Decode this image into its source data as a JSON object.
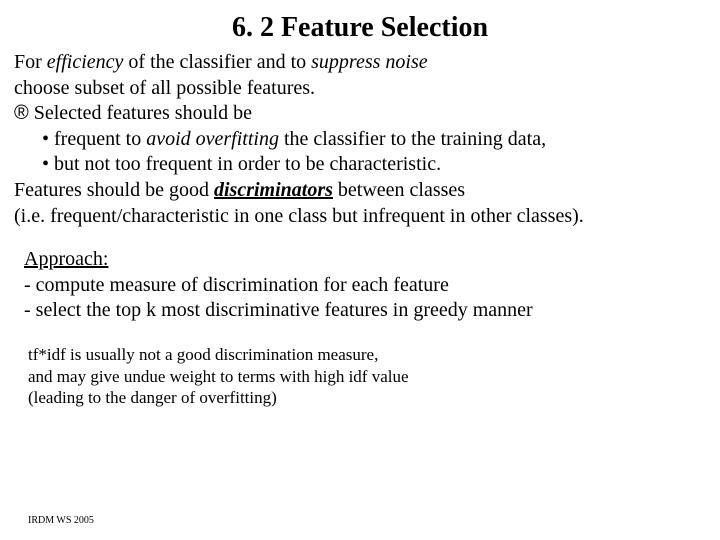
{
  "title": "6. 2 Feature Selection",
  "b1": {
    "l1a": "For ",
    "l1b": "efficiency",
    "l1c": " of the classifier and to ",
    "l1d": "suppress noise",
    "l2": "choose subset of all possible features.",
    "l3arrow": "®",
    "l3": " Selected features should be",
    "l4a": "• frequent to ",
    "l4b": "avoid overfitting",
    "l4c": " the classifier to the training data,",
    "l5": "• but not too frequent in order to be characteristic.",
    "l6a": "Features should be good ",
    "l6b": "discriminators",
    "l6c": " between classes",
    "l7": "(i.e. frequent/characteristic in one class but infrequent in other classes)."
  },
  "b2": {
    "l1": "Approach:",
    "l2": "- compute measure of discrimination for each feature",
    "l3": "- select the top k most discriminative features in greedy manner"
  },
  "b3": {
    "l1": "tf*idf is usually not a good discrimination measure,",
    "l2": "and may give undue weight to terms with high idf value",
    "l3": "(leading to the danger of overfitting)"
  },
  "footer": "IRDM  WS 2005"
}
